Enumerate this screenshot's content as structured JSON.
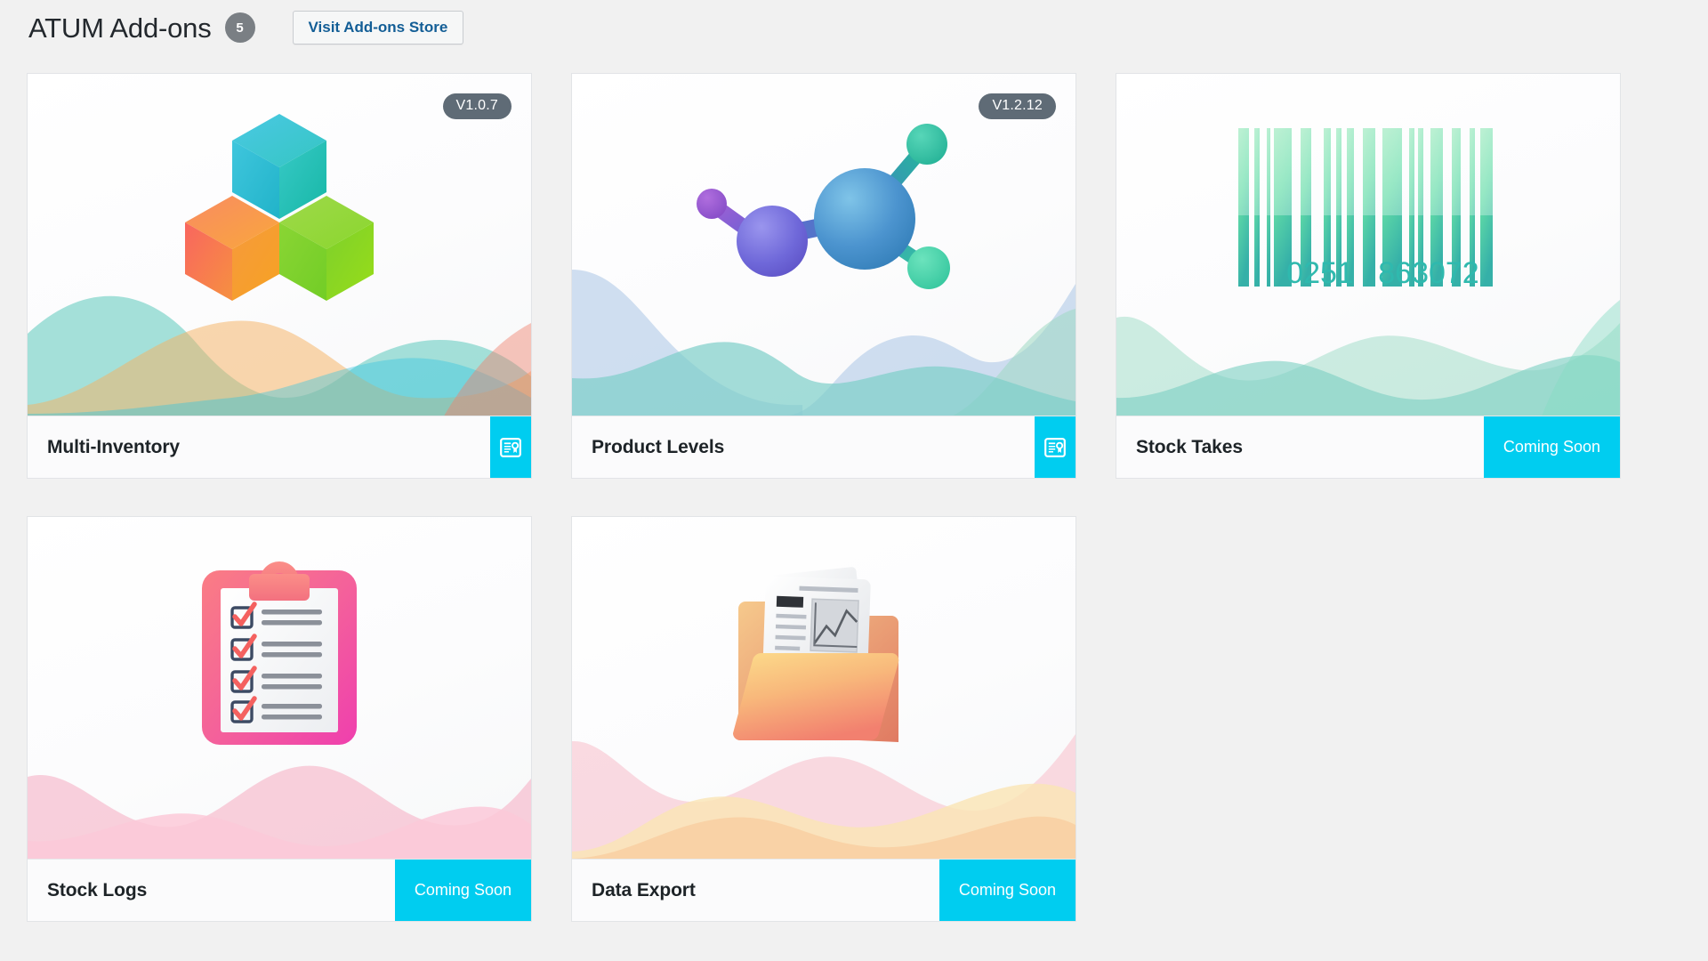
{
  "header": {
    "title": "ATUM Add-ons",
    "count": "5",
    "store_button": "Visit Add-ons Store"
  },
  "colors": {
    "accent_cyan": "#00cdf0",
    "link_blue": "#135e96",
    "badge_gray": "#5f6b76",
    "count_badge": "#7a7f84",
    "page_bg": "#f1f1f1",
    "card_bg": "#ffffff",
    "card_border": "#e2e4e7",
    "title_text": "#1d2327"
  },
  "addons": [
    {
      "name": "Multi-Inventory",
      "version": "V1.0.7",
      "has_version": true,
      "action": "license",
      "action_label": "",
      "art": "cubes-icon",
      "waves": "teal-orange"
    },
    {
      "name": "Product Levels",
      "version": "V1.2.12",
      "has_version": true,
      "action": "license",
      "action_label": "",
      "art": "molecule-icon",
      "waves": "blue-mint"
    },
    {
      "name": "Stock Takes",
      "version": "",
      "has_version": false,
      "action": "coming-soon",
      "action_label": "Coming Soon",
      "art": "barcode-icon",
      "waves": "green-mint",
      "barcode_left": "0251",
      "barcode_right": "863072"
    },
    {
      "name": "Stock Logs",
      "version": "",
      "has_version": false,
      "action": "coming-soon",
      "action_label": "Coming Soon",
      "art": "clipboard-icon",
      "waves": "pink"
    },
    {
      "name": "Data Export",
      "version": "",
      "has_version": false,
      "action": "coming-soon",
      "action_label": "Coming Soon",
      "art": "folder-chart-icon",
      "waves": "peach-pink"
    }
  ]
}
